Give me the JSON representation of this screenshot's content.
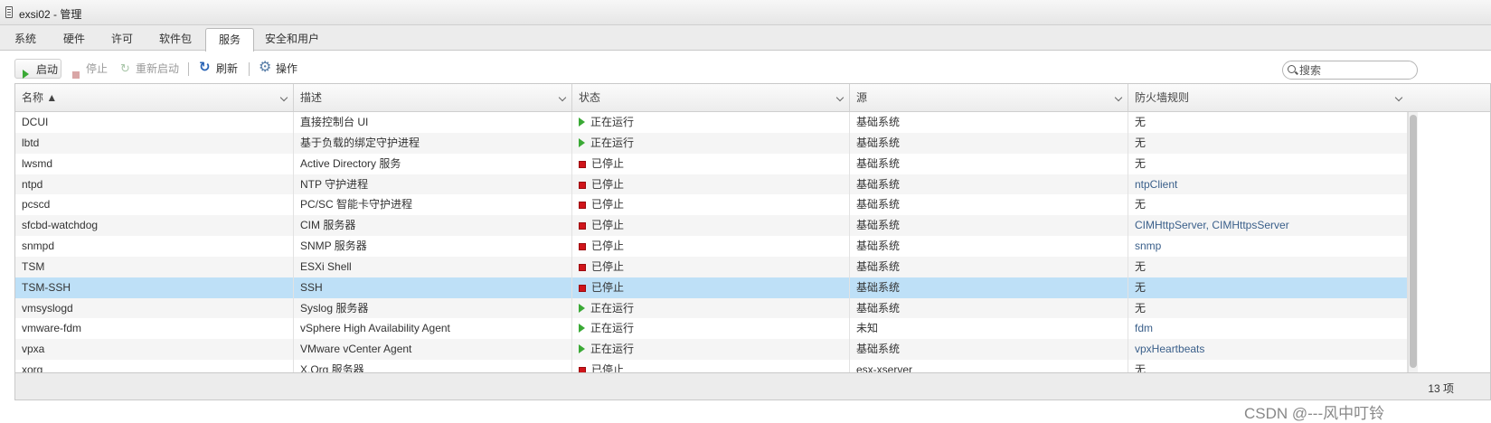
{
  "window": {
    "title": "exsi02 - 管理"
  },
  "tabs": [
    {
      "label": "系统",
      "active": false
    },
    {
      "label": "硬件",
      "active": false
    },
    {
      "label": "许可",
      "active": false
    },
    {
      "label": "软件包",
      "active": false
    },
    {
      "label": "服务",
      "active": true
    },
    {
      "label": "安全和用户",
      "active": false
    }
  ],
  "toolbar": {
    "start_label": "启动",
    "stop_label": "停止",
    "restart_label": "重新启动",
    "refresh_label": "刷新",
    "actions_label": "操作"
  },
  "search": {
    "placeholder": "搜索",
    "value": ""
  },
  "table": {
    "columns": [
      "名称 ▲",
      "描述",
      "状态",
      "源",
      "防火墙规则"
    ],
    "rows": [
      {
        "name": "DCUI",
        "description": "直接控制台 UI",
        "status": "正在运行",
        "state": "running",
        "source": "基础系统",
        "firewall": "无"
      },
      {
        "name": "lbtd",
        "description": "基于负载的绑定守护进程",
        "status": "正在运行",
        "state": "running",
        "source": "基础系统",
        "firewall": "无"
      },
      {
        "name": "lwsmd",
        "description": "Active Directory 服务",
        "status": "已停止",
        "state": "stopped",
        "source": "基础系统",
        "firewall": "无"
      },
      {
        "name": "ntpd",
        "description": "NTP 守护进程",
        "status": "已停止",
        "state": "stopped",
        "source": "基础系统",
        "firewall": "ntpClient"
      },
      {
        "name": "pcscd",
        "description": "PC/SC 智能卡守护进程",
        "status": "已停止",
        "state": "stopped",
        "source": "基础系统",
        "firewall": "无"
      },
      {
        "name": "sfcbd-watchdog",
        "description": "CIM 服务器",
        "status": "已停止",
        "state": "stopped",
        "source": "基础系统",
        "firewall": "CIMHttpServer, CIMHttpsServer"
      },
      {
        "name": "snmpd",
        "description": "SNMP 服务器",
        "status": "已停止",
        "state": "stopped",
        "source": "基础系统",
        "firewall": "snmp"
      },
      {
        "name": "TSM",
        "description": "ESXi Shell",
        "status": "已停止",
        "state": "stopped",
        "source": "基础系统",
        "firewall": "无"
      },
      {
        "name": "TSM-SSH",
        "description": "SSH",
        "status": "已停止",
        "state": "stopped",
        "source": "基础系统",
        "firewall": "无",
        "selected": true
      },
      {
        "name": "vmsyslogd",
        "description": "Syslog 服务器",
        "status": "正在运行",
        "state": "running",
        "source": "基础系统",
        "firewall": "无"
      },
      {
        "name": "vmware-fdm",
        "description": "vSphere High Availability Agent",
        "status": "正在运行",
        "state": "running",
        "source": "未知",
        "firewall": "fdm"
      },
      {
        "name": "vpxa",
        "description": "VMware vCenter Agent",
        "status": "正在运行",
        "state": "running",
        "source": "基础系统",
        "firewall": "vpxHeartbeats"
      },
      {
        "name": "xorg",
        "description": "X.Org 服务器",
        "status": "已停止",
        "state": "stopped",
        "source": "esx-xserver",
        "firewall": "无"
      }
    ]
  },
  "footer": {
    "count_label": "13 项"
  },
  "watermark": "CSDN @---风中叮铃"
}
